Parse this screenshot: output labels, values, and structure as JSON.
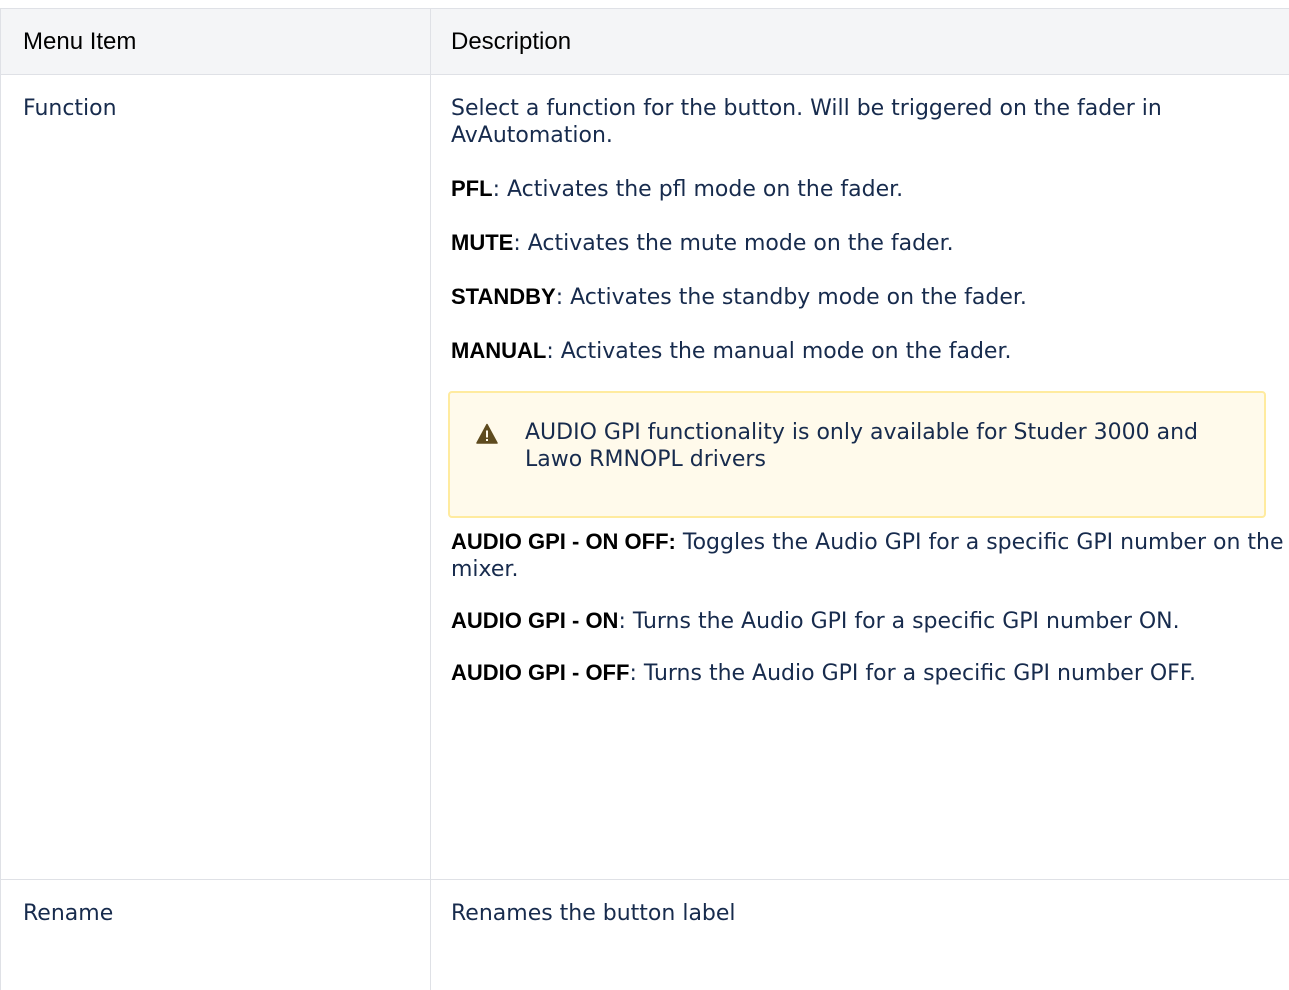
{
  "table": {
    "headers": [
      "Menu Item",
      "Description"
    ],
    "rows": [
      {
        "label": "Function",
        "intro": "Select a function for the button. Will be triggered on the fader in AvAutomation.",
        "options": [
          {
            "term": "PFL",
            "sep": ":",
            "text": " Activates the pfl mode on the fader."
          },
          {
            "term": "MUTE",
            "sep": ":",
            "text": " Activates the mute mode on the fader."
          },
          {
            "term": "STANDBY",
            "sep": ":",
            "text": " Activates the standby mode on the fader."
          },
          {
            "term": "MANUAL",
            "sep": ":",
            "text": " Activates the manual mode on the fader."
          }
        ],
        "warning": {
          "icon": "warning-icon",
          "text": "AUDIO GPI functionality is only available for Studer 3000 and Lawo RMNOPL drivers"
        },
        "gpi_options": [
          {
            "term": "AUDIO GPI - ON OFF:",
            "text": " Toggles the Audio GPI for a specific GPI number on the mixer."
          },
          {
            "term": "AUDIO GPI - ON",
            "text": ": Turns the Audio GPI for a specific GPI number ON."
          },
          {
            "term": "AUDIO GPI - OFF",
            "text": ": Turns the Audio GPI for a specific GPI number OFF."
          }
        ]
      },
      {
        "label": "Rename",
        "description": "Renames the button label"
      }
    ]
  },
  "colors": {
    "border": "#dfe1e6",
    "header_bg": "#f4f5f7",
    "warning_bg": "#fffaeb",
    "warning_border": "#ffeb9f",
    "warning_icon": "#5e4b1e"
  }
}
